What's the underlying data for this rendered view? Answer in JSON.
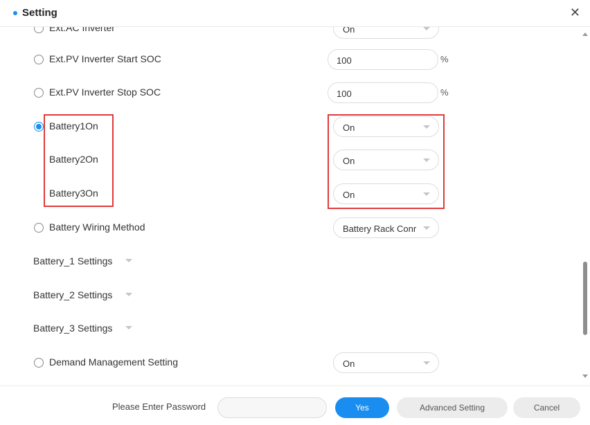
{
  "dialog": {
    "title": "Setting"
  },
  "rows": {
    "ext_ac_inverter": {
      "label": "Ext.AC Inverter",
      "value": "On"
    },
    "pv_start_soc": {
      "label": "Ext.PV Inverter Start SOC",
      "value": "100",
      "unit": "%"
    },
    "pv_stop_soc": {
      "label": "Ext.PV Inverter Stop SOC",
      "value": "100",
      "unit": "%"
    },
    "battery1": {
      "label": "Battery1On",
      "value": "On"
    },
    "battery2": {
      "label": "Battery2On",
      "value": "On"
    },
    "battery3": {
      "label": "Battery3On",
      "value": "On"
    },
    "wiring": {
      "label": "Battery Wiring Method",
      "value": "Battery Rack Conr"
    },
    "b1_settings": {
      "label": "Battery_1 Settings"
    },
    "b2_settings": {
      "label": "Battery_2 Settings"
    },
    "b3_settings": {
      "label": "Battery_3 Settings"
    },
    "demand": {
      "label": "Demand Management Setting",
      "value": "On"
    }
  },
  "footer": {
    "password_label": "Please Enter Password",
    "yes": "Yes",
    "advanced": "Advanced Setting",
    "cancel": "Cancel"
  },
  "colors": {
    "accent": "#1a8df0",
    "highlight": "#e03a3a"
  }
}
